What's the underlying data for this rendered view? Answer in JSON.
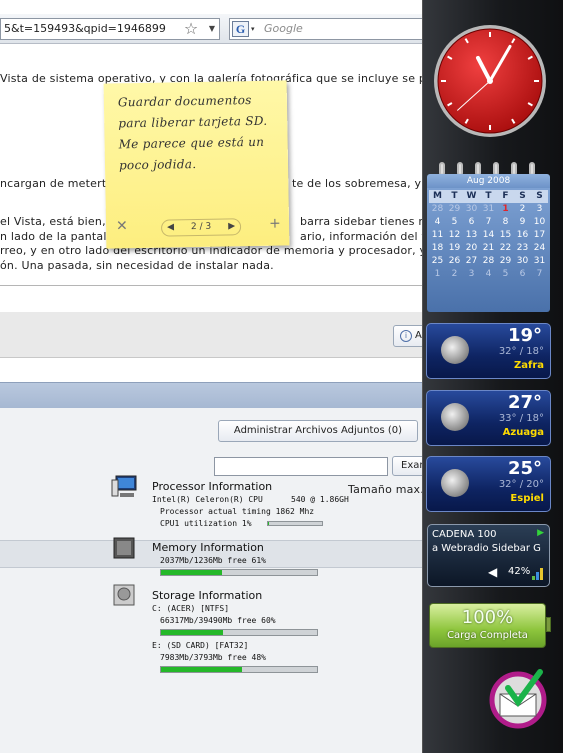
{
  "browser": {
    "url_fragment": "5&t=159493&qpid=1946899",
    "search_placeholder": "Google",
    "search_engine_letter": "G"
  },
  "article": {
    "line1": "Vista de sistema operativo, y con la galería fotográfica que se incluye se p",
    "line2a": "ncargan de metert",
    "line2b": "te de los sobremesa, y d",
    "line3a": "el Vista, está bien,",
    "line3b": "barra sidebar tienes mo",
    "line4a": "n lado de la pantall",
    "line4b": "ario, información del tie",
    "line5": "rreo, y en otro lado del escritorio un indicador de memoria y procesador, y",
    "line6": "ón. Una pasada, sin necesidad de instalar nada."
  },
  "forum": {
    "btn_partial": "A",
    "manage_attachments": "Administrar Archivos Adjuntos (0)",
    "exam_partial": "Exam",
    "max_size": "Tamaño max."
  },
  "sticky_note": {
    "lines": [
      "Guardar documentos",
      "para liberar tarjeta SD.",
      "Me parece que está un",
      "poco jodida."
    ],
    "pager": "2 / 3",
    "close": "✕",
    "add": "+"
  },
  "system_monitor": {
    "processor": {
      "title": "Processor Information",
      "cpu": "Intel(R) Celeron(R) CPU",
      "speed": "540  @ 1.86GH",
      "timing": "Processor actual timing 1862 Mhz",
      "util": "CPU1 utilization  1%",
      "util_fraction": 0.01
    },
    "memory": {
      "title": "Memory Information",
      "usage": "2037Mb/1236Mb  free 61%",
      "used_fraction": 0.39
    },
    "storage": {
      "title": "Storage Information",
      "drive_c": "C: (ACER)  [NTFS]",
      "drive_c_usage": "66317Mb/39490Mb  free 60%",
      "drive_c_used_fraction": 0.4,
      "drive_e": "E: (SD CARD)  [FAT32]",
      "drive_e_usage": "7983Mb/3793Mb  free 48%",
      "drive_e_used_fraction": 0.52
    }
  },
  "calendar": {
    "month": "Aug 2008",
    "days": [
      "M",
      "T",
      "W",
      "T",
      "F",
      "S",
      "S"
    ],
    "weeks": [
      [
        "28",
        "29",
        "30",
        "31",
        "1",
        "2",
        "3"
      ],
      [
        "4",
        "5",
        "6",
        "7",
        "8",
        "9",
        "10"
      ],
      [
        "11",
        "12",
        "13",
        "14",
        "15",
        "16",
        "17"
      ],
      [
        "18",
        "19",
        "20",
        "21",
        "22",
        "23",
        "24"
      ],
      [
        "25",
        "26",
        "27",
        "28",
        "29",
        "30",
        "31"
      ],
      [
        "1",
        "2",
        "3",
        "4",
        "5",
        "6",
        "7"
      ]
    ],
    "today": "1"
  },
  "weather": [
    {
      "temp": "19°",
      "range": "32° / 18°",
      "city": "Zafra"
    },
    {
      "temp": "27°",
      "range": "33° / 18°",
      "city": "Azuaga"
    },
    {
      "temp": "25°",
      "range": "32° / 20°",
      "city": "Espiel"
    }
  ],
  "radio": {
    "line1": "CADENA 100",
    "line2": "a Webradio Sidebar G",
    "volume": "42%",
    "volume_fraction": 0.42
  },
  "battery": {
    "percent": "100%",
    "status": "Carga Completa"
  },
  "clock": {
    "hour": 11,
    "minute": 5,
    "second": 38
  }
}
